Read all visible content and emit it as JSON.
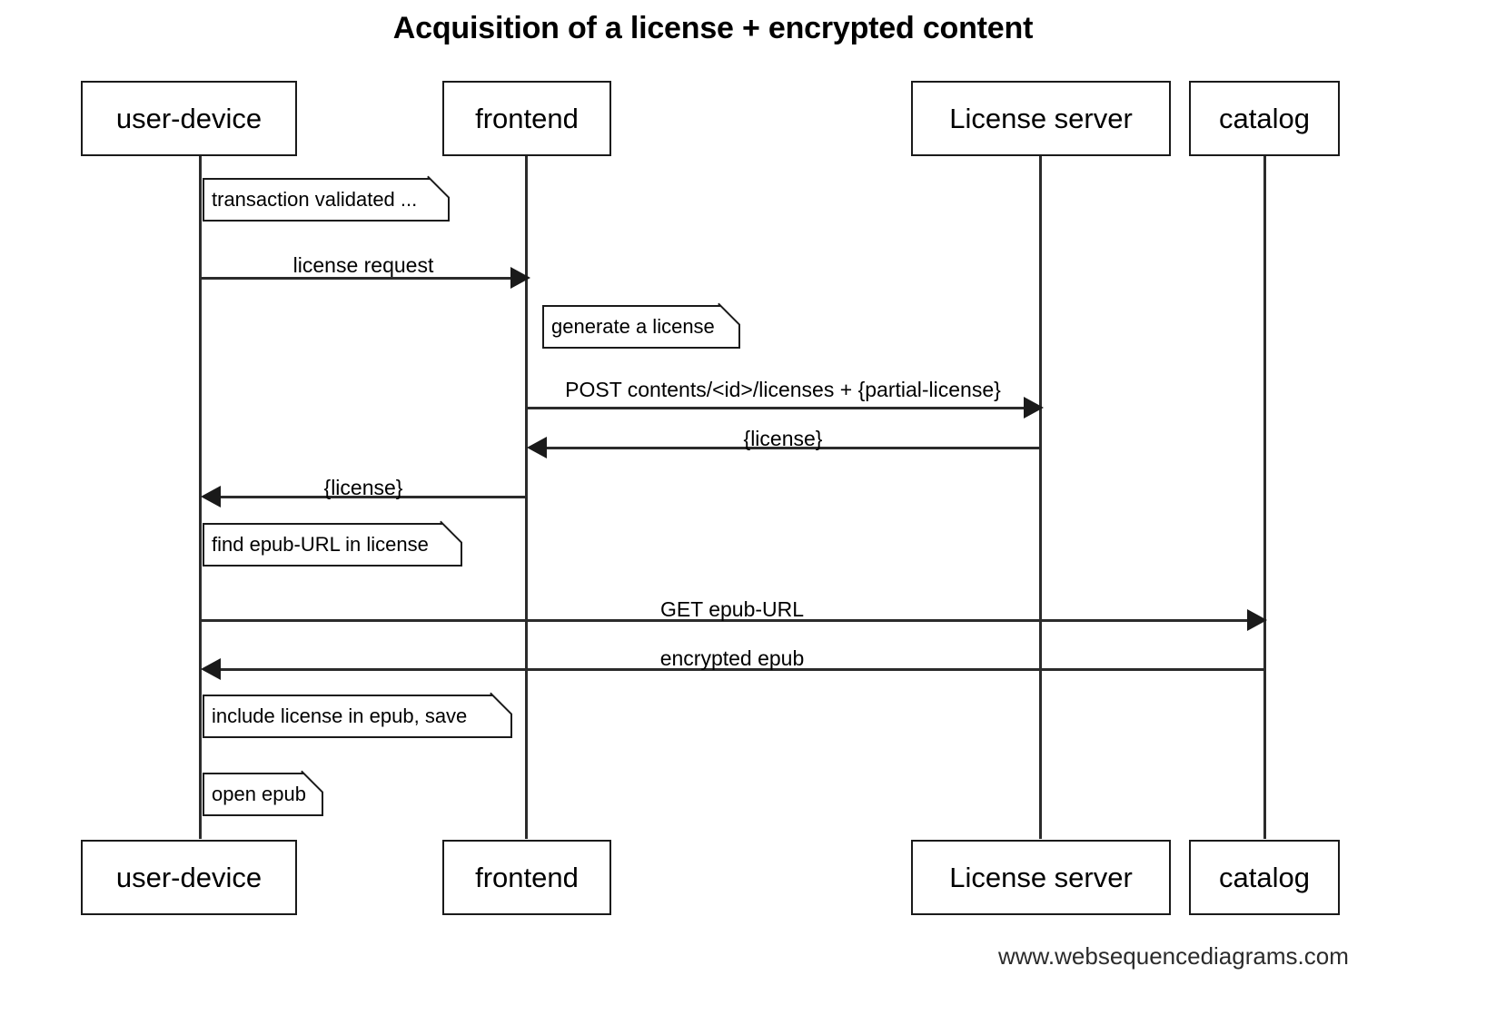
{
  "title": "Acquisition of a license + encrypted content",
  "watermark": "www.websequencediagrams.com",
  "colors": {
    "stroke": "#1a1a1a",
    "line": "#2b2b2b",
    "background": "#ffffff",
    "text": "#000000"
  },
  "participants": [
    {
      "id": "user-device",
      "label": "user-device"
    },
    {
      "id": "frontend",
      "label": "frontend"
    },
    {
      "id": "license-server",
      "label": "License server"
    },
    {
      "id": "catalog",
      "label": "catalog"
    }
  ],
  "notes": [
    {
      "id": "note-transaction-validated",
      "text": "transaction validated ...",
      "over": "user-device"
    },
    {
      "id": "note-generate-license",
      "text": "generate a license",
      "over": "frontend"
    },
    {
      "id": "note-find-epub-url",
      "text": "find epub-URL in license",
      "over": "user-device"
    },
    {
      "id": "note-include-license",
      "text": "include  license in epub, save",
      "over": "user-device"
    },
    {
      "id": "note-open-epub",
      "text": "open epub",
      "over": "user-device"
    }
  ],
  "messages": [
    {
      "id": "msg-license-request",
      "label": "license request",
      "from": "user-device",
      "to": "frontend",
      "direction": "right"
    },
    {
      "id": "msg-post-licenses",
      "label": "POST contents/<id>/licenses + {partial-license}",
      "from": "frontend",
      "to": "license-server",
      "direction": "right"
    },
    {
      "id": "msg-license-return-server",
      "label": "{license}",
      "from": "license-server",
      "to": "frontend",
      "direction": "left"
    },
    {
      "id": "msg-license-return-frontend",
      "label": "{license}",
      "from": "frontend",
      "to": "user-device",
      "direction": "left"
    },
    {
      "id": "msg-get-epub-url",
      "label": "GET epub-URL",
      "from": "user-device",
      "to": "catalog",
      "direction": "right"
    },
    {
      "id": "msg-encrypted-epub",
      "label": "encrypted epub",
      "from": "catalog",
      "to": "user-device",
      "direction": "left"
    }
  ]
}
